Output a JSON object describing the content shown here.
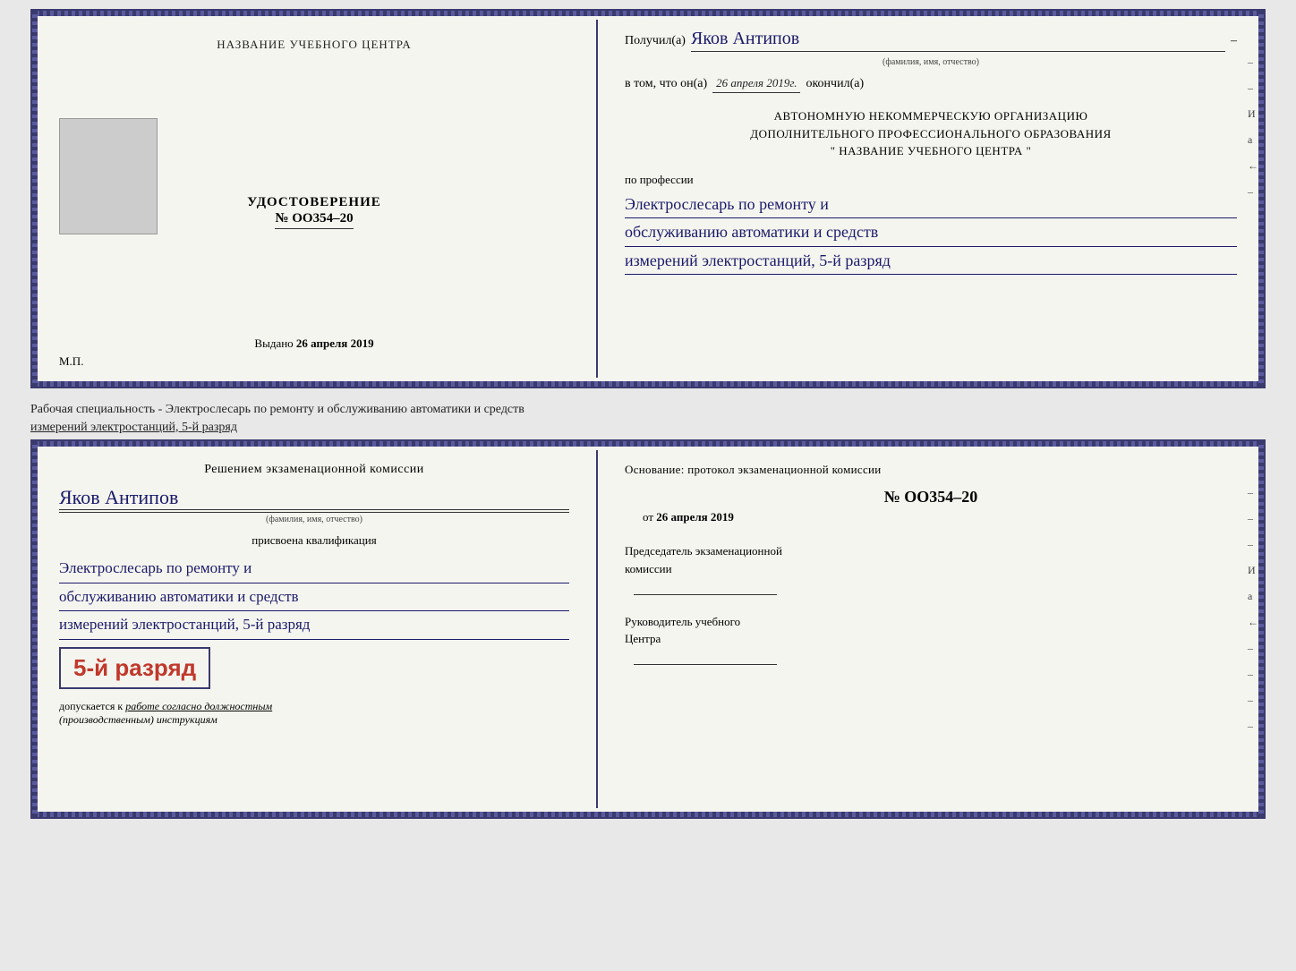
{
  "doc1": {
    "left": {
      "title": "НАЗВАНИЕ УЧЕБНОГО ЦЕНТРА",
      "cert_label": "УДОСТОВЕРЕНИЕ",
      "cert_number": "№ OO354–20",
      "issued_label": "Выдано",
      "issued_date": "26 апреля 2019",
      "mp_label": "М.П."
    },
    "right": {
      "received_prefix": "Получил(а)",
      "recipient_name": "Яков Антипов",
      "recipient_subtitle": "(фамилия, имя, отчество)",
      "in_that_prefix": "в том, что он(а)",
      "completion_date": "26 апреля 2019г.",
      "completed_label": "окончил(а)",
      "org_line1": "АВТОНОМНУЮ НЕКОММЕРЧЕСКУЮ ОРГАНИЗАЦИЮ",
      "org_line2": "ДОПОЛНИТЕЛЬНОГО ПРОФЕССИОНАЛЬНОГО ОБРАЗОВАНИЯ",
      "org_line3": "\"   НАЗВАНИЕ УЧЕБНОГО ЦЕНТРА   \"",
      "profession_prefix": "по профессии",
      "profession_line1": "Электрослесарь по ремонту и",
      "profession_line2": "обслуживанию автоматики и средств",
      "profession_line3": "измерений электростанций, 5-й разряд",
      "side_marks": [
        "–",
        "–",
        "И",
        "а",
        "←",
        "–"
      ]
    }
  },
  "specialty_text": "Рабочая специальность - Электрослесарь по ремонту и обслуживанию автоматики и средств\nизмерений электростанций, 5-й разряд",
  "doc2": {
    "left": {
      "decision_text": "Решением экзаменационной комиссии",
      "recipient_name": "Яков Антипов",
      "recipient_subtitle": "(фамилия, имя, отчество)",
      "qualification_label": "присвоена квалификация",
      "qual_line1": "Электрослесарь по ремонту и",
      "qual_line2": "обслуживанию автоматики и средств",
      "qual_line3": "измерений электростанций, 5-й разряд",
      "rank_text": "5-й разряд",
      "allowed_prefix": "допускается к",
      "allowed_text": "работе согласно должностным",
      "allowed_text2": "(производственным) инструкциям"
    },
    "right": {
      "basis_label": "Основание: протокол экзаменационной комиссии",
      "protocol_number": "№ OO354–20",
      "date_prefix": "от",
      "protocol_date": "26 апреля 2019",
      "chairman_label": "Председатель экзаменационной",
      "chairman_label2": "комиссии",
      "director_label": "Руководитель учебного",
      "director_label2": "Центра",
      "side_marks": [
        "–",
        "–",
        "–",
        "И",
        "а",
        "←",
        "–",
        "–",
        "–",
        "–"
      ]
    }
  }
}
